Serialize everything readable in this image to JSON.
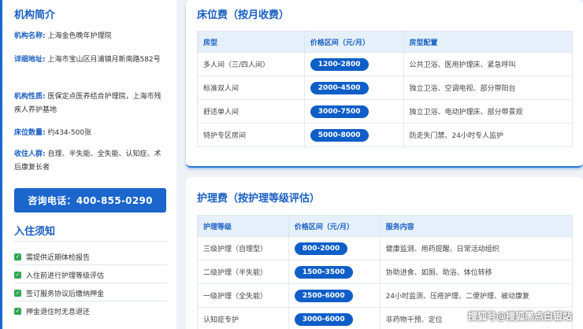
{
  "intro": {
    "title": "机构简介",
    "name_key": "机构名称:",
    "name_val": "上海金色晚年护理院",
    "addr_key": "详细地址:",
    "addr_val": "上海市宝山区月浦镇月新南路582号",
    "nature_key": "机构性质:",
    "nature_val": "医保定点医养结合护理院，上海市残疾人养护基地",
    "beds_key": "床位数量:",
    "beds_val": "约434-500张",
    "people_key": "收住人群:",
    "people_val": "自理、半失能、全失能、认知症、术后康复长者"
  },
  "consult_button": "咨询电话：400-855-0290",
  "notice": {
    "title": "入住须知",
    "items": [
      "需提供近期体检报告",
      "入住前进行护理等级评估",
      "签订服务协议后缴纳押金",
      "押金退住时无息退还"
    ]
  },
  "bed_fee": {
    "title": "床位费（按月收费）",
    "headers": [
      "房型",
      "价格区间（元/月）",
      "房型配置"
    ],
    "rows": [
      [
        "多人间（三/四人间）",
        "1200-2800",
        "公共卫浴、医用护理床、紧急呼叫"
      ],
      [
        "标准双人间",
        "2000-4500",
        "独立卫浴、空调电视、部分带阳台"
      ],
      [
        "舒适单人间",
        "3000-7500",
        "独立卫浴、电动护理床、部分带景观"
      ],
      [
        "特护专区房间",
        "5000-8000",
        "防走失门禁、24小时专人监护"
      ]
    ]
  },
  "care_fee": {
    "title": "护理费（按护理等级评估）",
    "headers": [
      "护理等级",
      "价格区间（元/月）",
      "服务内容"
    ],
    "rows": [
      [
        "三级护理（自理型）",
        "800-2000",
        "健康监测、用药提醒、日常活动组织"
      ],
      [
        "二级护理（半失能）",
        "1500-3500",
        "协助进食、如厕、助浴、体位转移"
      ],
      [
        "一级护理（全失能）",
        "2500-6000",
        "24小时监测、压疮护理、二便护理、被动康复"
      ],
      [
        "认知症专护",
        "3000-6000",
        "非药物干预、定位"
      ]
    ]
  },
  "watermark": "搜狐号@搜狐黑点白银站",
  "colors": {
    "accent": "#1a66cc",
    "pill": "#0f5ec8",
    "check": "#2fa84f"
  }
}
